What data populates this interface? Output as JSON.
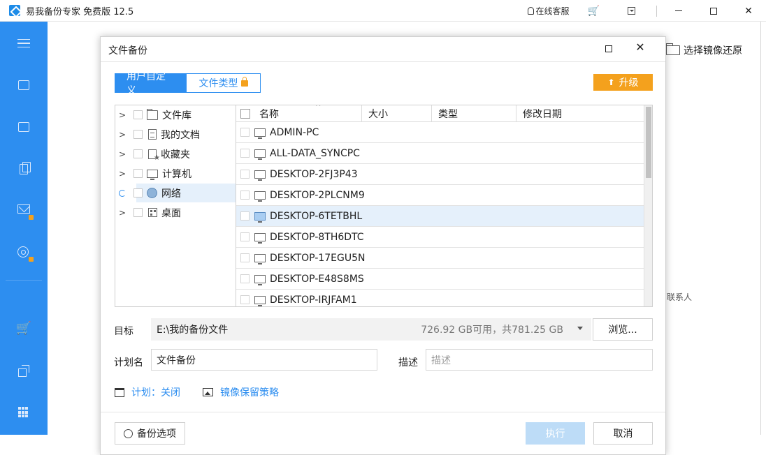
{
  "app": {
    "title": "易我备份专家 免费版 12.5",
    "support_label": "在线客服",
    "cart_icon": "cart-icon"
  },
  "background": {
    "restore_label": "选择镜像还原",
    "contacts_label": "联系人"
  },
  "dialog": {
    "title": "文件备份",
    "tabs": [
      {
        "label": "用户自定义",
        "active": true
      },
      {
        "label": "文件类型",
        "active": false,
        "locked": true
      }
    ],
    "upgrade_label": "升级",
    "tree": [
      {
        "label": "文件库",
        "icon": "folder-icon",
        "state": "collapsed"
      },
      {
        "label": "我的文档",
        "icon": "document-icon",
        "state": "collapsed"
      },
      {
        "label": "收藏夹",
        "icon": "favorites-icon",
        "state": "collapsed"
      },
      {
        "label": "计算机",
        "icon": "computer-icon",
        "state": "collapsed"
      },
      {
        "label": "网络",
        "icon": "network-globe-icon",
        "state": "loading",
        "selected": true
      },
      {
        "label": "桌面",
        "icon": "desktop-icon",
        "state": "collapsed"
      }
    ],
    "columns": {
      "name": "名称",
      "size": "大小",
      "type": "类型",
      "modified": "修改日期"
    },
    "files": [
      {
        "name": "ADMIN-PC",
        "selected": false
      },
      {
        "name": "ALL-DATA_SYNCPC",
        "selected": false
      },
      {
        "name": "DESKTOP-2FJ3P43",
        "selected": false
      },
      {
        "name": "DESKTOP-2PLCNM9",
        "selected": false
      },
      {
        "name": "DESKTOP-6TETBHL",
        "selected": true
      },
      {
        "name": "DESKTOP-8TH6DTC",
        "selected": false
      },
      {
        "name": "DESKTOP-17EGU5N",
        "selected": false
      },
      {
        "name": "DESKTOP-E48S8MS",
        "selected": false
      },
      {
        "name": "DESKTOP-IRJFAM1",
        "selected": false
      }
    ],
    "target": {
      "label": "目标",
      "path": "E:\\我的备份文件",
      "space": "726.92 GB可用，共781.25 GB",
      "browse_label": "浏览..."
    },
    "plan": {
      "label": "计划名",
      "value": "文件备份"
    },
    "description": {
      "label": "描述",
      "placeholder": "描述"
    },
    "schedule_label": "计划：关闭",
    "retention_label": "镜像保留策略",
    "options_label": "备份选项",
    "run_label": "执行",
    "cancel_label": "取消"
  },
  "colors": {
    "accent": "#2d8ef0",
    "upgrade": "#f4a11d",
    "selection": "#e5f0fb"
  }
}
